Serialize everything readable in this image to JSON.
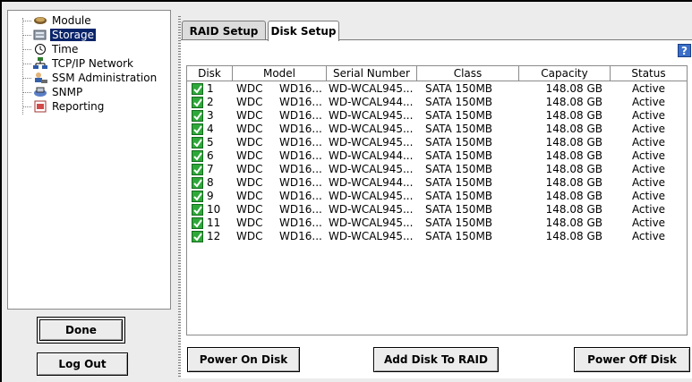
{
  "nav": {
    "items": [
      {
        "label": "Module",
        "icon": "module-icon"
      },
      {
        "label": "Storage",
        "icon": "storage-icon",
        "selected": true
      },
      {
        "label": "Time",
        "icon": "clock-icon"
      },
      {
        "label": "TCP/IP Network",
        "icon": "network-icon"
      },
      {
        "label": "SSM Administration",
        "icon": "admin-icon"
      },
      {
        "label": "SNMP",
        "icon": "snmp-icon"
      },
      {
        "label": "Reporting",
        "icon": "reporting-icon"
      }
    ],
    "done_label": "Done",
    "logout_label": "Log Out"
  },
  "tabs": [
    {
      "label": "RAID Setup",
      "active": false
    },
    {
      "label": "Disk Setup",
      "active": true
    }
  ],
  "help_label": "?",
  "table": {
    "columns": [
      "Disk",
      "Model",
      "Serial Number",
      "Class",
      "Capacity",
      "Status"
    ],
    "rows": [
      {
        "disk": "1",
        "model_vendor": "WDC",
        "model": "WD16...",
        "serial": "WD-WCAL945...",
        "class": "SATA 150MB",
        "capacity": "148.08 GB",
        "status": "Active",
        "checked": true
      },
      {
        "disk": "2",
        "model_vendor": "WDC",
        "model": "WD16...",
        "serial": "WD-WCAL944...",
        "class": "SATA 150MB",
        "capacity": "148.08 GB",
        "status": "Active",
        "checked": true
      },
      {
        "disk": "3",
        "model_vendor": "WDC",
        "model": "WD16...",
        "serial": "WD-WCAL945...",
        "class": "SATA 150MB",
        "capacity": "148.08 GB",
        "status": "Active",
        "checked": true
      },
      {
        "disk": "4",
        "model_vendor": "WDC",
        "model": "WD16...",
        "serial": "WD-WCAL945...",
        "class": "SATA 150MB",
        "capacity": "148.08 GB",
        "status": "Active",
        "checked": true
      },
      {
        "disk": "5",
        "model_vendor": "WDC",
        "model": "WD16...",
        "serial": "WD-WCAL945...",
        "class": "SATA 150MB",
        "capacity": "148.08 GB",
        "status": "Active",
        "checked": true
      },
      {
        "disk": "6",
        "model_vendor": "WDC",
        "model": "WD16...",
        "serial": "WD-WCAL944...",
        "class": "SATA 150MB",
        "capacity": "148.08 GB",
        "status": "Active",
        "checked": true
      },
      {
        "disk": "7",
        "model_vendor": "WDC",
        "model": "WD16...",
        "serial": "WD-WCAL945...",
        "class": "SATA 150MB",
        "capacity": "148.08 GB",
        "status": "Active",
        "checked": true
      },
      {
        "disk": "8",
        "model_vendor": "WDC",
        "model": "WD16...",
        "serial": "WD-WCAL944...",
        "class": "SATA 150MB",
        "capacity": "148.08 GB",
        "status": "Active",
        "checked": true
      },
      {
        "disk": "9",
        "model_vendor": "WDC",
        "model": "WD16...",
        "serial": "WD-WCAL945...",
        "class": "SATA 150MB",
        "capacity": "148.08 GB",
        "status": "Active",
        "checked": true
      },
      {
        "disk": "10",
        "model_vendor": "WDC",
        "model": "WD16...",
        "serial": "WD-WCAL945...",
        "class": "SATA 150MB",
        "capacity": "148.08 GB",
        "status": "Active",
        "checked": true
      },
      {
        "disk": "11",
        "model_vendor": "WDC",
        "model": "WD16...",
        "serial": "WD-WCAL945...",
        "class": "SATA 150MB",
        "capacity": "148.08 GB",
        "status": "Active",
        "checked": true
      },
      {
        "disk": "12",
        "model_vendor": "WDC",
        "model": "WD16...",
        "serial": "WD-WCAL945...",
        "class": "SATA 150MB",
        "capacity": "148.08 GB",
        "status": "Active",
        "checked": true
      }
    ]
  },
  "actions": {
    "power_on_label": "Power On Disk",
    "add_to_raid_label": "Add Disk To RAID",
    "power_off_label": "Power Off Disk"
  },
  "colors": {
    "selection": "#0a246a",
    "checkbox": "#2fa83a",
    "help": "#3a6ec8",
    "splitter_arrow": "#1f4fbf"
  }
}
